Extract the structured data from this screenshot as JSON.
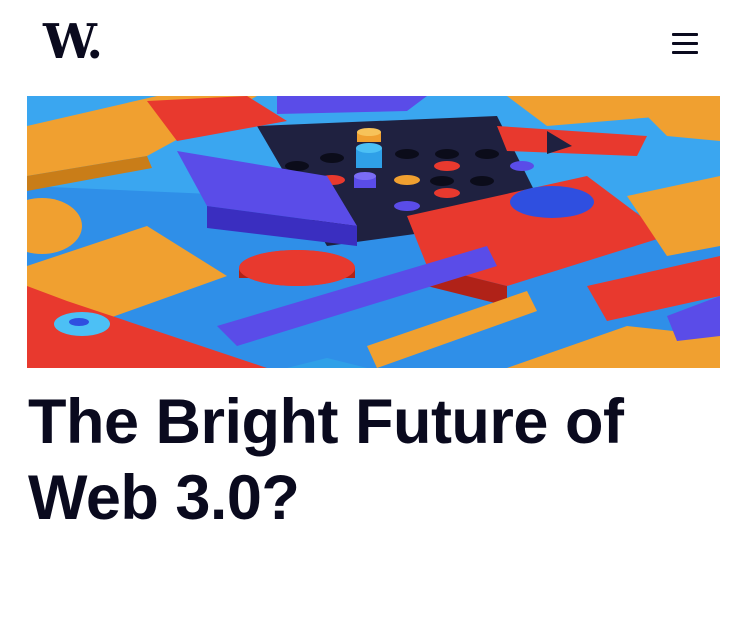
{
  "header": {
    "logo_text": "W.",
    "menu_icon": "hamburger-menu-icon"
  },
  "hero": {
    "image_description_icon": "abstract-3d-blocks-image"
  },
  "article": {
    "title": "The Bright Future of Web 3.0?"
  },
  "colors": {
    "text": "#0a0a1e",
    "background": "#ffffff",
    "hero_blue": "#2f63e8",
    "hero_orange": "#f0a030",
    "hero_red": "#e8392e",
    "hero_navy": "#1f2140"
  }
}
